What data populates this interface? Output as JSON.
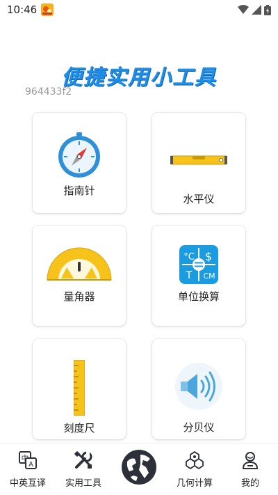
{
  "status_bar": {
    "time": "10:46",
    "icons": [
      "app-notification-icon",
      "wifi-icon",
      "signal-icon",
      "battery-icon"
    ]
  },
  "banner": {
    "title": "便捷实用小工具",
    "build_id": "964433f2",
    "title_color": "#1e8fe8"
  },
  "tools": {
    "compass": {
      "label": "指南针",
      "icon": "compass-icon"
    },
    "level": {
      "label": "水平仪",
      "icon": "spirit-level-icon"
    },
    "protractor": {
      "label": "量角器",
      "icon": "protractor-icon"
    },
    "unit_convert": {
      "label": "单位换算",
      "icon": "unit-conversion-icon"
    },
    "ruler": {
      "label": "刻度尺",
      "icon": "ruler-icon"
    },
    "decibel": {
      "label": "分贝仪",
      "icon": "speaker-icon"
    }
  },
  "bottom_nav": {
    "items": [
      {
        "label": "中英互译",
        "icon": "translate-icon"
      },
      {
        "label": "实用工具",
        "icon": "tools-icon"
      },
      {
        "label": "",
        "icon": "globe-icon"
      },
      {
        "label": "几何计算",
        "icon": "geometry-icon"
      },
      {
        "label": "我的",
        "icon": "profile-icon"
      }
    ]
  },
  "colors": {
    "accent_blue": "#1e8fe8",
    "tool_yellow": "#f7c21a",
    "nav_dark": "#2d3038"
  }
}
